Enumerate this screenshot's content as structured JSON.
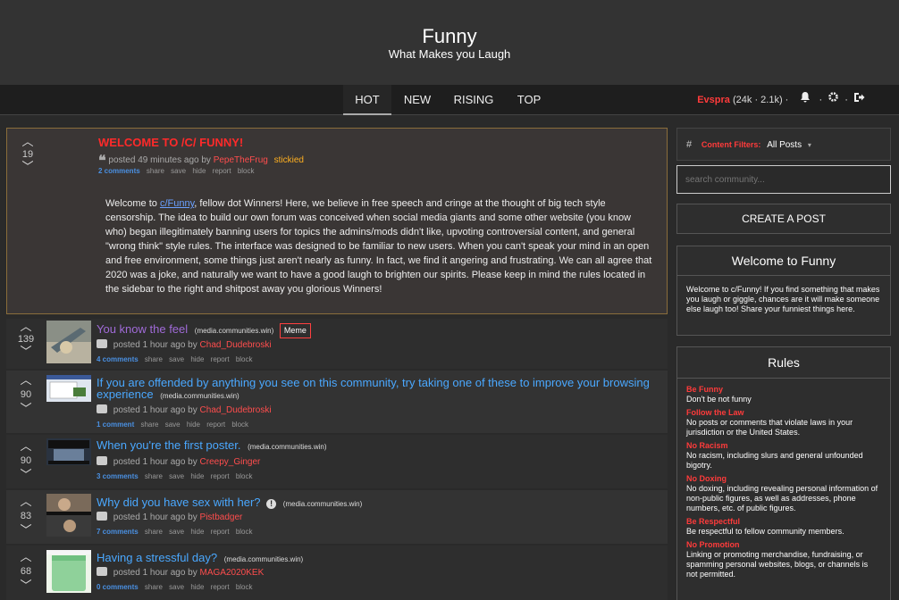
{
  "header": {
    "title": "Funny",
    "subtitle": "What Makes you Laugh"
  },
  "nav": {
    "tabs": [
      "HOT",
      "NEW",
      "RISING",
      "TOP"
    ],
    "user": {
      "name": "Evspra",
      "karma": "(24k · 2.1k) ·"
    }
  },
  "sticky": {
    "score": "19",
    "title": "WELCOME TO /C/ FUNNY!",
    "posted": "posted 49 minutes ago by",
    "author": "PepeTheFrug",
    "tag": "stickied",
    "comments": "2 comments",
    "body_pre": "Welcome to",
    "body_link": "c/Funny",
    "body_post": ", fellow dot Winners! Here, we believe in free speech and cringe at the thought of big tech style censorship. The idea to build our own forum was conceived when social media giants and some other website (you know who) began illegitimately banning users for topics the admins/mods didn't like, upvoting controversial content, and general \"wrong think\" style rules. The interface was designed to be familiar to new users. When you can't speak your mind in an open and free environment, some things just aren't nearly as funny. In fact, we find it angering and frustrating. We can all agree that 2020 was a joke, and naturally we want to have a good laugh to brighten our spirits. Please keep in mind the rules located in the sidebar to the right and shitpost away you glorious Winners!"
  },
  "actions": {
    "share": "share",
    "save": "save",
    "hide": "hide",
    "report": "report",
    "block": "block"
  },
  "posts": [
    {
      "score": "139",
      "title": "You know the feel",
      "domain": "(media.communities.win)",
      "flair": "Meme",
      "posted": "posted 1 hour ago by",
      "author": "Chad_Dudebroski",
      "comments": "4 comments"
    },
    {
      "score": "90",
      "title": "If you are offended by anything you see on this community, try taking one of these to improve your browsing experience",
      "domain": "(media.communities.win)",
      "posted": "posted 1 hour ago by",
      "author": "Chad_Dudebroski",
      "comments": "1 comment"
    },
    {
      "score": "90",
      "title": "When you're the first poster.",
      "domain": "(media.communities.win)",
      "posted": "posted 1 hour ago by",
      "author": "Creepy_Ginger",
      "comments": "3 comments"
    },
    {
      "score": "83",
      "title": "Why did you have sex with her?",
      "domain": "(media.communities.win)",
      "posted": "posted 1 hour ago by",
      "author": "Pistbadger",
      "comments": "7 comments"
    },
    {
      "score": "68",
      "title": "Having a stressful day?",
      "domain": "(media.communities.win)",
      "posted": "posted 1 hour ago by",
      "author": "MAGA2020KEK",
      "comments": "0 comments"
    }
  ],
  "sidebar": {
    "filter_label": "Content Filters:",
    "filter_value": "All Posts",
    "search_placeholder": "search community...",
    "create_label": "CREATE A POST",
    "welcome_title": "Welcome to Funny",
    "welcome_body": "Welcome to c/Funny! If you find something that makes you laugh or giggle, chances are it will make someone else laugh too! Share your funniest things here.",
    "rules_title": "Rules",
    "rules": [
      {
        "name": "Be Funny",
        "desc": "Don't be not funny"
      },
      {
        "name": "Follow the Law",
        "desc": "No posts or comments that violate laws in your jurisdiction or the United States."
      },
      {
        "name": "No Racism",
        "desc": "No racism, including slurs and general unfounded bigotry."
      },
      {
        "name": "No Doxing",
        "desc": "No doxing, including revealing personal information of non-public figures, as well as addresses, phone numbers, etc. of public figures."
      },
      {
        "name": "Be Respectful",
        "desc": "Be respectful to fellow community members."
      },
      {
        "name": "No Promotion",
        "desc": "Linking or promoting merchandise, fundraising, or spamming personal websites, blogs, or channels is not permitted."
      }
    ]
  }
}
